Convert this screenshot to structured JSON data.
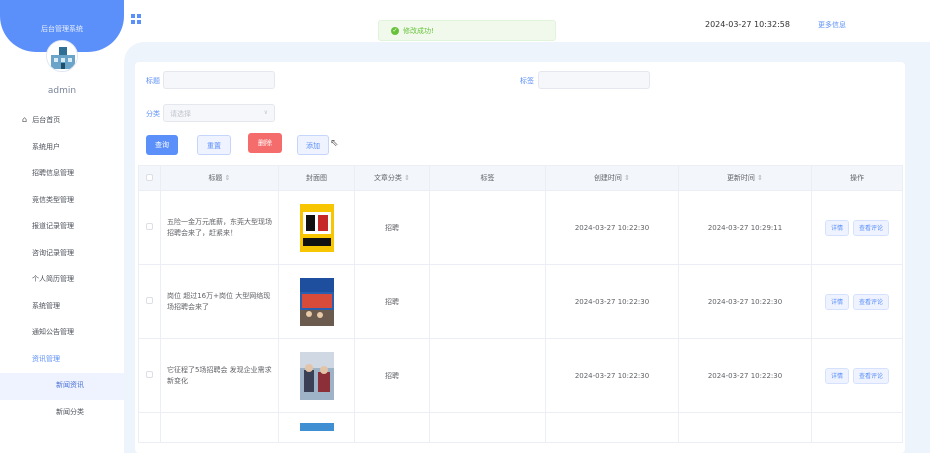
{
  "app": {
    "system_title": "后台管理系统",
    "username": "admin"
  },
  "header": {
    "datetime": "2024-03-27 10:32:58",
    "more_link": "更多信息"
  },
  "toast": {
    "message": "修改成功!"
  },
  "sidebar": {
    "items": [
      {
        "label": "后台首页"
      },
      {
        "label": "系统用户"
      },
      {
        "label": "招聘信息管理"
      },
      {
        "label": "竞信类型管理"
      },
      {
        "label": "报道记录管理"
      },
      {
        "label": "咨询记录管理"
      },
      {
        "label": "个人简历管理"
      },
      {
        "label": "系统管理"
      },
      {
        "label": "通知公告管理"
      },
      {
        "label": "资讯管理"
      },
      {
        "label": "新闻资讯"
      },
      {
        "label": "新闻分类"
      }
    ]
  },
  "filters": {
    "title_label": "标题",
    "tag_label": "标签",
    "category_label": "分类",
    "category_placeholder": "请选择"
  },
  "actions": {
    "query": "查询",
    "reset": "重置",
    "delete": "删除",
    "add": "添加"
  },
  "table": {
    "headers": [
      "标题",
      "封面图",
      "文章分类",
      "标签",
      "创建时间",
      "更新时间",
      "操作"
    ],
    "rows": [
      {
        "title": "五险一金万元底薪，东莞大型现场招聘会来了，赶紧来！",
        "category": "招聘",
        "tag": "",
        "created": "2024-03-27 10:22:30",
        "updated": "2024-03-27 10:29:11",
        "op_detail": "详情",
        "op_review": "查看评论"
      },
      {
        "title": "岗位 超过16万+岗位 大型网络现场招聘会来了",
        "category": "招聘",
        "tag": "",
        "created": "2024-03-27 10:22:30",
        "updated": "2024-03-27 10:22:30",
        "op_detail": "详情",
        "op_review": "查看评论"
      },
      {
        "title": "它征程了5场招聘会 发现企业需求新变化",
        "category": "招聘",
        "tag": "",
        "created": "2024-03-27 10:22:30",
        "updated": "2024-03-27 10:22:30",
        "op_detail": "详情",
        "op_review": "查看评论"
      }
    ]
  },
  "colors": {
    "primary": "#5b8ff9",
    "danger": "#f56c6c",
    "success": "#67c23a"
  }
}
